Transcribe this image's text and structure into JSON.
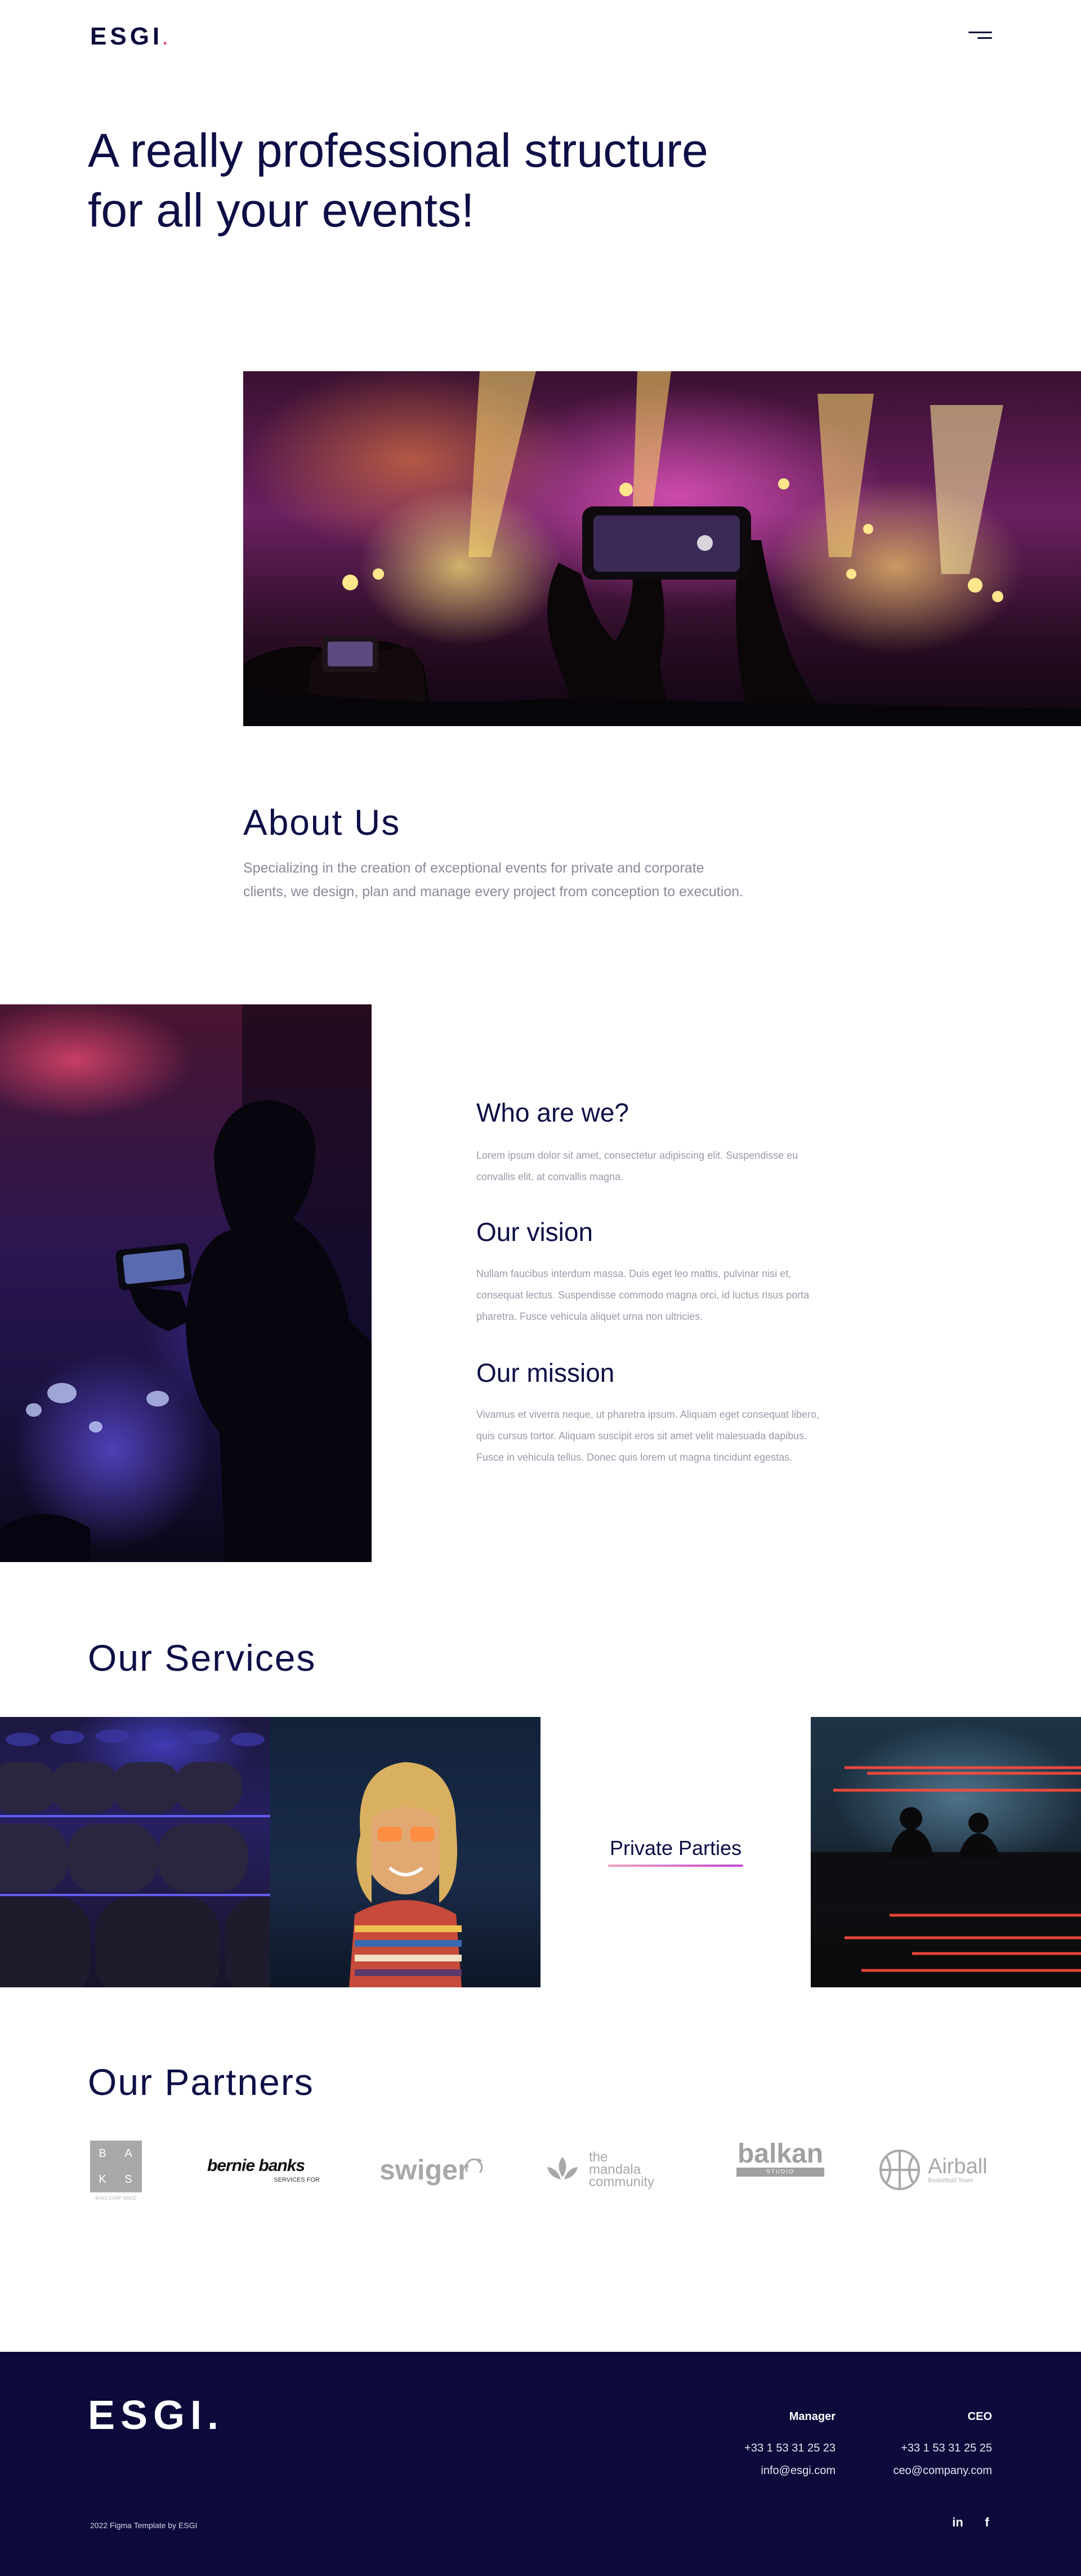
{
  "header": {
    "logo_text": "ESGI",
    "logo_dot": ".",
    "menu_icon": "hamburger-menu-icon"
  },
  "hero": {
    "title_line1": "A really professional structure",
    "title_line2": "for all your events!"
  },
  "about": {
    "title": "About Us",
    "text": "Specializing in the creation of exceptional events for private and corporate clients, we design, plan and manage every project from conception to execution."
  },
  "who": {
    "sections": [
      {
        "heading": "Who are we?",
        "text": "Lorem ipsum dolor sit amet, consectetur adipiscing elit. Suspendisse eu convallis elit, at convallis magna."
      },
      {
        "heading": "Our vision",
        "text": " Nullam faucibus interdum massa. Duis eget leo mattis, pulvinar nisi et, consequat lectus. Suspendisse commodo magna orci, id luctus risus porta pharetra. Fusce vehicula aliquet urna non ultricies."
      },
      {
        "heading": "Our mission",
        "text": "Vivamus et viverra neque, ut pharetra ipsum. Aliquam eget consequat libero, quis cursus tortor. Aliquam suscipit eros sit amet velit malesuada dapibus. Fusce in vehicula tellus. Donec quis lorem ut magna tincidunt egestas."
      }
    ]
  },
  "services": {
    "title": "Our Services",
    "items": [
      {
        "label": ""
      },
      {
        "label": ""
      },
      {
        "label": "Private Parties"
      },
      {
        "label": ""
      }
    ],
    "accent_gradient": [
      "#f0a0c0",
      "#c044d0"
    ]
  },
  "partners": {
    "title": "Our Partners",
    "logos": {
      "baks": {
        "letters": [
          "B",
          "A",
          "K",
          "S"
        ],
        "subtitle": "BAKS CORP SINCE"
      },
      "bernie": {
        "name": "bernie banks",
        "sub": "SERVICES FOR"
      },
      "swiger": {
        "name": "swiger"
      },
      "mandala": {
        "line1": "the",
        "line2": "mandala",
        "line3": "community"
      },
      "balkan": {
        "name": "balkan",
        "sub": "STUDIO ARCHITECTURE"
      },
      "airball": {
        "name": "Airball",
        "sub": "Basketball Team"
      }
    }
  },
  "footer": {
    "logo_text": "ESGI.",
    "contacts": [
      {
        "role": "Manager",
        "phone": "+33 1 53 31 25 23",
        "email": "info@esgi.com"
      },
      {
        "role": "CEO",
        "phone": "+33 1 53 31 25 25",
        "email": "ceo@company.com"
      }
    ],
    "copyright": "2022  Figma Template by ESGI",
    "social": {
      "linkedin": "in",
      "facebook": "f"
    }
  },
  "colors": {
    "navy": "#0b0a3a",
    "heading": "#0d0e45",
    "accent_pink": "#e23a8a",
    "body_text": "#8a8a9a"
  }
}
